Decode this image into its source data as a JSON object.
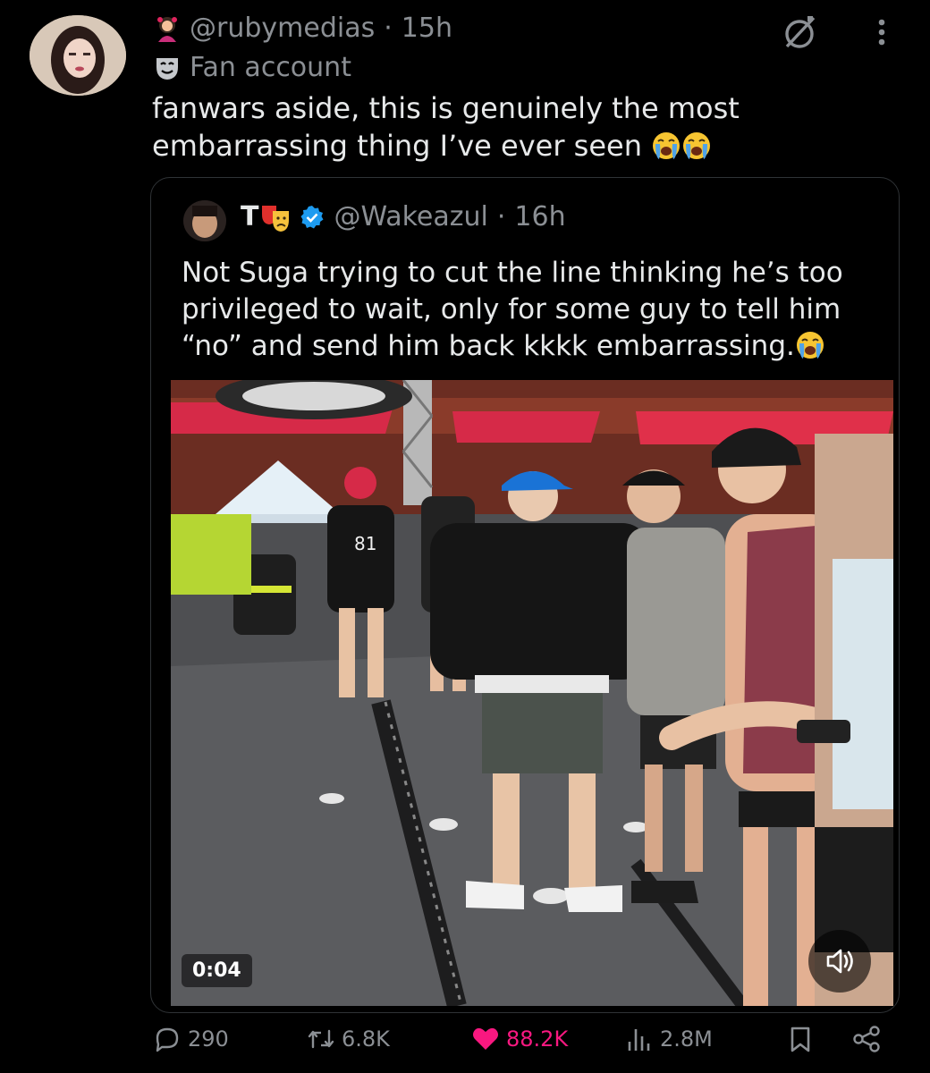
{
  "post": {
    "handle": "@rubymedias",
    "separator": "·",
    "time": "15h",
    "label": "Fan account",
    "text": "fanwars aside, this is genuinely the most embarrassing thing I’ve ever seen"
  },
  "quote": {
    "name": "T",
    "handle": "@Wakeazul",
    "separator": "·",
    "time": "16h",
    "text": "Not Suga trying to cut the line thinking he’s too privileged to wait, only for some guy to tell him “no” and send him back kkkk embarrassing.",
    "video": {
      "timestamp": "0:04"
    }
  },
  "actions": {
    "replies": "290",
    "reposts": "6.8K",
    "likes": "88.2K",
    "views": "2.8M"
  },
  "colors": {
    "background": "#000000",
    "text": "#e7e9ea",
    "muted": "#8b8f94",
    "like": "#f91880",
    "verified": "#1d9bf0",
    "border": "#2f3336"
  }
}
